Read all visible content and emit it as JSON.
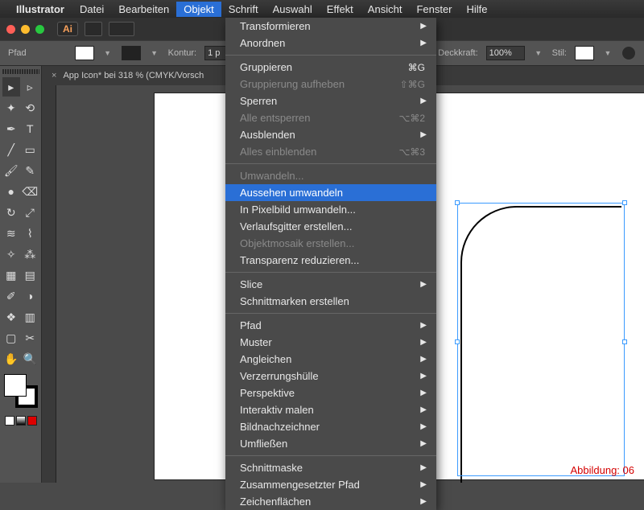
{
  "menubar": {
    "app": "Illustrator",
    "items": [
      "Datei",
      "Bearbeiten",
      "Objekt",
      "Schrift",
      "Auswahl",
      "Effekt",
      "Ansicht",
      "Fenster",
      "Hilfe"
    ],
    "active_index": 2
  },
  "titlebar": {
    "badge": "Ai"
  },
  "ctrlbar": {
    "object_label": "Pfad",
    "kontur_label": "Kontur:",
    "kontur_value": "1 p",
    "deckkraft_label": "Deckkraft:",
    "deckkraft_value": "100%",
    "stil_label": "Stil:"
  },
  "tab": {
    "close": "×",
    "title": "App Icon* bei 318 % (CMYK/Vorsch"
  },
  "dropdown": {
    "groups": [
      [
        {
          "label": "Transformieren",
          "sub": true
        },
        {
          "label": "Anordnen",
          "sub": true
        }
      ],
      [
        {
          "label": "Gruppieren",
          "short": "⌘G"
        },
        {
          "label": "Gruppierung aufheben",
          "short": "⇧⌘G",
          "disabled": true
        },
        {
          "label": "Sperren",
          "sub": true
        },
        {
          "label": "Alle entsperren",
          "short": "⌥⌘2",
          "disabled": true
        },
        {
          "label": "Ausblenden",
          "sub": true
        },
        {
          "label": "Alles einblenden",
          "short": "⌥⌘3",
          "disabled": true
        }
      ],
      [
        {
          "label": "Umwandeln...",
          "disabled": true
        },
        {
          "label": "Aussehen umwandeln",
          "hi": true
        },
        {
          "label": "In Pixelbild umwandeln..."
        },
        {
          "label": "Verlaufsgitter erstellen..."
        },
        {
          "label": "Objektmosaik erstellen...",
          "disabled": true
        },
        {
          "label": "Transparenz reduzieren..."
        }
      ],
      [
        {
          "label": "Slice",
          "sub": true
        },
        {
          "label": "Schnittmarken erstellen"
        }
      ],
      [
        {
          "label": "Pfad",
          "sub": true
        },
        {
          "label": "Muster",
          "sub": true
        },
        {
          "label": "Angleichen",
          "sub": true
        },
        {
          "label": "Verzerrungshülle",
          "sub": true
        },
        {
          "label": "Perspektive",
          "sub": true
        },
        {
          "label": "Interaktiv malen",
          "sub": true
        },
        {
          "label": "Bildnachzeichner",
          "sub": true
        },
        {
          "label": "Umfließen",
          "sub": true
        }
      ],
      [
        {
          "label": "Schnittmaske",
          "sub": true
        },
        {
          "label": "Zusammengesetzter Pfad",
          "sub": true
        },
        {
          "label": "Zeichenflächen",
          "sub": true
        }
      ]
    ]
  },
  "caption": "Abbildung: 06",
  "tools_rows": [
    [
      "sel",
      "dsel"
    ],
    [
      "wand",
      "lasso"
    ],
    [
      "pen",
      "type"
    ],
    [
      "line",
      "rect"
    ],
    [
      "brush",
      "pencil"
    ],
    [
      "blob",
      "eraser"
    ],
    [
      "rotate",
      "scale"
    ],
    [
      "width",
      "warp"
    ],
    [
      "shb",
      "spray"
    ],
    [
      "mesh",
      "grad"
    ],
    [
      "eyedrop",
      "blend"
    ],
    [
      "sym",
      "graph"
    ],
    [
      "artb",
      "slice"
    ],
    [
      "hand",
      "zoom"
    ]
  ]
}
